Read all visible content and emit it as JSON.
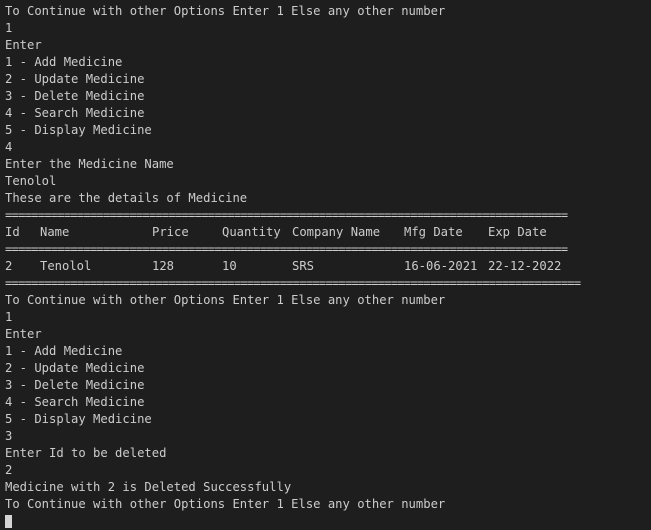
{
  "terminal": {
    "lines_a": [
      "To Continue with other Options Enter 1 Else any other number",
      "1",
      "Enter",
      "1 - Add Medicine",
      "2 - Update Medicine",
      "3 - Delete Medicine",
      "4 - Search Medicine",
      "5 - Display Medicine",
      "4",
      "Enter the Medicine Name",
      "Tenolol",
      "These are the details of Medicine"
    ],
    "separator_short": "======================================================================================",
    "separator_long": "========================================================================================",
    "table": {
      "headers": [
        "Id",
        "Name",
        "Price",
        "Quantity",
        "Company Name",
        "Mfg Date",
        "Exp Date"
      ],
      "row": [
        "2",
        "Tenolol",
        "128",
        "10",
        "SRS",
        "16-06-2021",
        "22-12-2022"
      ]
    },
    "lines_b": [
      "To Continue with other Options Enter 1 Else any other number",
      "1",
      "Enter",
      "1 - Add Medicine",
      "2 - Update Medicine",
      "3 - Delete Medicine",
      "4 - Search Medicine",
      "5 - Display Medicine",
      "3",
      "Enter Id to be deleted",
      "2",
      "Medicine with 2 is Deleted Successfully",
      "To Continue with other Options Enter 1 Else any other number"
    ]
  }
}
